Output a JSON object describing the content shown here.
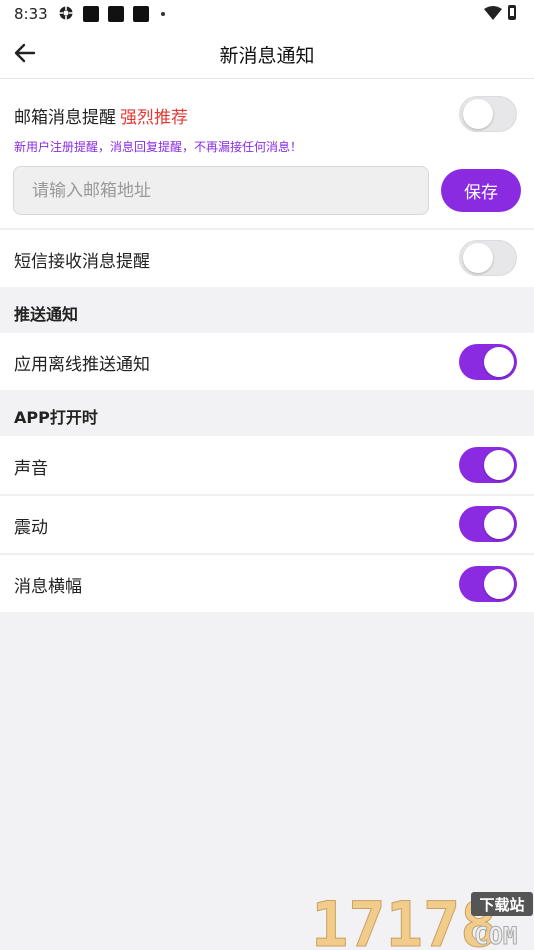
{
  "status_bar": {
    "time": "8:33"
  },
  "app_bar": {
    "title": "新消息通知"
  },
  "email_section": {
    "label": "邮箱消息提醒",
    "recommend": "强烈推荐",
    "enabled": false,
    "hint": "新用户注册提醒，消息回复提醒，不再漏接任何消息！",
    "input_placeholder": "请输入邮箱地址",
    "input_value": "",
    "save_label": "保存"
  },
  "sms_section": {
    "label": "短信接收消息提醒",
    "enabled": false
  },
  "push_section": {
    "header": "推送通知",
    "items": [
      {
        "label": "应用离线推送通知",
        "enabled": true
      }
    ]
  },
  "app_open_section": {
    "header": "APP打开时",
    "items": [
      {
        "label": "声音",
        "enabled": true
      },
      {
        "label": "震动",
        "enabled": true
      },
      {
        "label": "消息横幅",
        "enabled": true
      }
    ]
  },
  "watermark": {
    "text": "17178",
    "badge": "下载站",
    "suffix": "COM"
  },
  "colors": {
    "accent": "#8a2be2",
    "recommend": "#e53935",
    "background": "#f2f2f4"
  },
  "icons": {
    "back": "arrow-left-icon",
    "wifi": "wifi-icon",
    "battery": "battery-icon"
  }
}
